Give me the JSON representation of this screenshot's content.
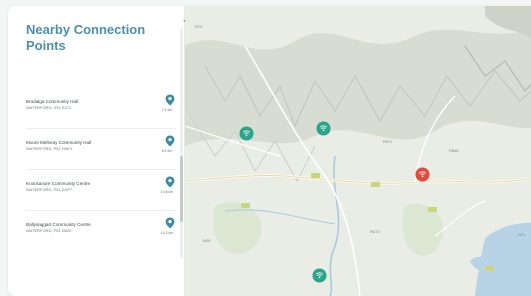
{
  "sidebar": {
    "title": "Nearby Connection Points",
    "collapse_icon": "triangle-left-icon",
    "items": [
      {
        "name": "Brodalga Community Hall",
        "address": "WATERFORD, X91 R272",
        "distance": "2.4 km"
      },
      {
        "name": "Mount Melleray Community Hall",
        "address": "WATERFORD, P51 H9K3",
        "distance": "8.9 km"
      },
      {
        "name": "Knockanore Community Centre",
        "address": "WATERFORD, P51 DVP7",
        "distance": "10.8 km"
      },
      {
        "name": "Ballysaggart Community Centre",
        "address": "WATERFORD, P51 D620",
        "distance": "14.3 km"
      }
    ]
  },
  "map": {
    "labels": [
      "N72",
      "R671",
      "R666",
      "N25",
      "R672",
      "N72"
    ],
    "markers": [
      {
        "type": "connection-point",
        "color": "#2aa58a"
      },
      {
        "type": "connection-point",
        "color": "#2aa58a"
      },
      {
        "type": "connection-point",
        "color": "#2aa58a"
      },
      {
        "type": "selected-location",
        "color": "#e24b3b"
      }
    ]
  },
  "colors": {
    "accent": "#4b8fb0",
    "pin": "#3d8aa6",
    "marker_green": "#2aa58a",
    "marker_red": "#e24b3b",
    "water": "#b9d3e6",
    "land": "#e9ede6"
  }
}
